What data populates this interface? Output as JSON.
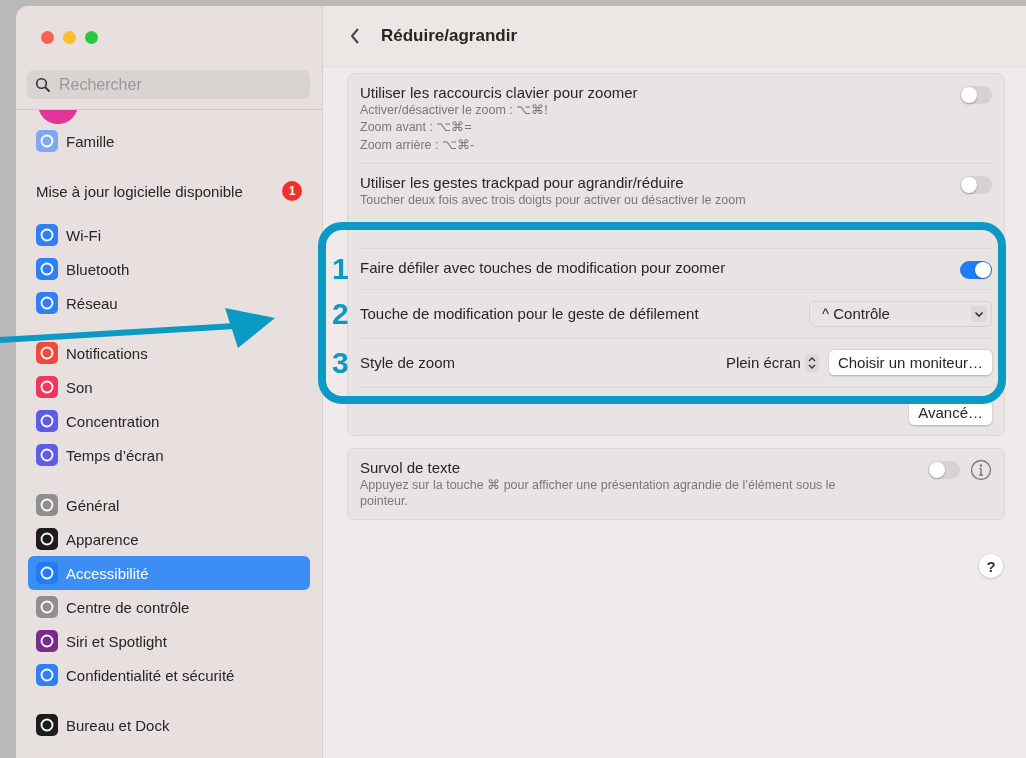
{
  "search": {
    "placeholder": "Rechercher"
  },
  "sidebar": {
    "groups": [
      [
        {
          "label": "Famille",
          "color": "#7fa8f0",
          "selected": false
        }
      ],
      [
        {
          "label": "Mise à jour logicielle disponible",
          "kind": "update",
          "badge": "1",
          "selected": false
        }
      ],
      [
        {
          "label": "Wi-Fi",
          "color": "#2f7ff5",
          "selected": false
        },
        {
          "label": "Bluetooth",
          "color": "#2f7ff5",
          "selected": false
        },
        {
          "label": "Réseau",
          "color": "#2f7ff5",
          "selected": false
        }
      ],
      [
        {
          "label": "Notifications",
          "color": "#f0493e",
          "selected": false
        },
        {
          "label": "Son",
          "color": "#f0365a",
          "selected": false
        },
        {
          "label": "Concentration",
          "color": "#5e5ce6",
          "selected": false
        },
        {
          "label": "Temps d’écran",
          "color": "#5e5ce6",
          "selected": false
        }
      ],
      [
        {
          "label": "Général",
          "color": "#8e8e93",
          "selected": false
        },
        {
          "label": "Apparence",
          "color": "#1c1c1e",
          "selected": false
        },
        {
          "label": "Accessibilité",
          "color": "#1f7cf4",
          "selected": true
        },
        {
          "label": "Centre de contrôle",
          "color": "#8e8e93",
          "selected": false
        },
        {
          "label": "Siri et Spotlight",
          "color": "#7a2a8a",
          "selected": false
        },
        {
          "label": "Confidentialité et sécurité",
          "color": "#2f7ff5",
          "selected": false
        }
      ],
      [
        {
          "label": "Bureau et Dock",
          "color": "#1c1c1e",
          "selected": false
        }
      ]
    ]
  },
  "header": {
    "title": "Réduire/agrandir"
  },
  "cards": [
    {
      "rows": [
        {
          "kind": "toggle",
          "label": "Utiliser les raccourcis clavier pour zoomer",
          "on": false,
          "lines": [
            "Activer/désactiver le zoom : ⌥⌘!",
            "Zoom avant : ⌥⌘=",
            "Zoom arrière : ⌥⌘-"
          ]
        },
        {
          "kind": "toggle",
          "label": "Utiliser les gestes trackpad pour agrandir/réduire",
          "on": false,
          "lines": [
            "Toucher deux fois avec trois doigts pour activer ou désactiver le zoom"
          ]
        },
        {
          "kind": "toggle",
          "label": "Faire défiler avec touches de modification pour zoomer",
          "on": true,
          "annotation": "1"
        },
        {
          "kind": "select",
          "label": "Touche de modification pour le geste de défilement",
          "value": "^ Contrôle",
          "annotation": "2"
        },
        {
          "kind": "style",
          "label": "Style de zoom",
          "value": "Plein écran",
          "button": "Choisir un moniteur…",
          "annotation": "3"
        },
        {
          "kind": "button",
          "button": "Avancé…"
        }
      ]
    },
    {
      "rows": [
        {
          "kind": "toggle",
          "label": "Survol de texte",
          "on": false,
          "info": true,
          "lines": [
            "Appuyez sur la touche ⌘ pour afficher une présentation agrandie de l’élément sous le pointeur."
          ]
        }
      ]
    }
  ],
  "help": "?"
}
